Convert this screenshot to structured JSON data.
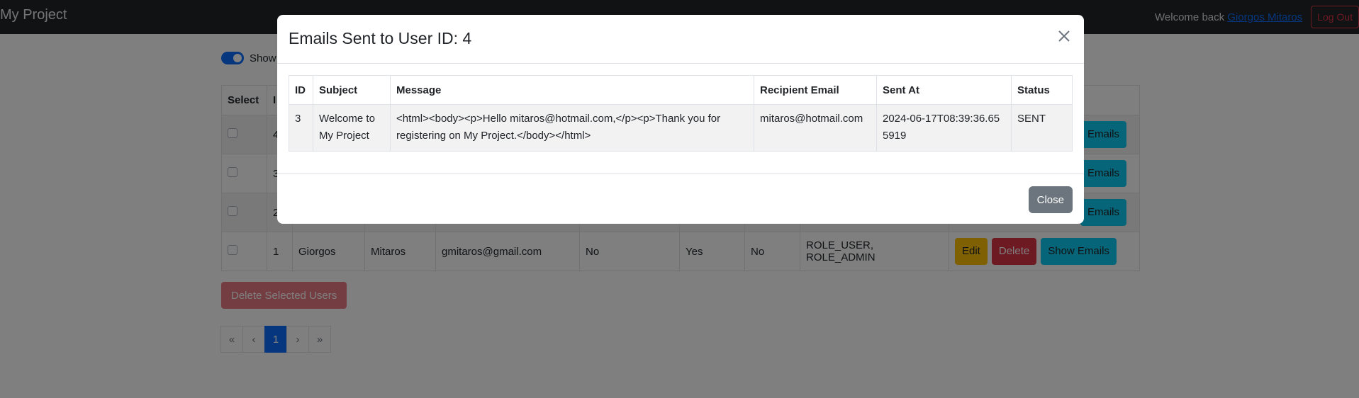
{
  "navbar": {
    "brand": "My Project",
    "welcome_text": "Welcome back",
    "user_name": "Giorgos Mitaros",
    "logout_label": "Log Out"
  },
  "page": {
    "toggle_label": "Show",
    "table": {
      "headers": [
        "Select",
        "I",
        "",
        "",
        "",
        "",
        "",
        "",
        "",
        ""
      ],
      "rows": [
        {
          "id": "4",
          "first": "",
          "last": "",
          "email": "",
          "verified": "",
          "enabled": "",
          "locked": "",
          "roles": "",
          "show_label": "Emails"
        },
        {
          "id": "3",
          "first": "",
          "last": "",
          "email": "",
          "verified": "",
          "enabled": "",
          "locked": "",
          "roles": "",
          "show_label": "Emails"
        },
        {
          "id": "2",
          "first": "",
          "last": "",
          "email": "",
          "verified": "",
          "enabled": "",
          "locked": "",
          "roles": "",
          "show_label": "Emails"
        },
        {
          "id": "1",
          "first": "Giorgos",
          "last": "Mitaros",
          "email": "gmitaros@gmail.com",
          "verified": "No",
          "enabled": "Yes",
          "locked": "No",
          "roles": "ROLE_USER, ROLE_ADMIN",
          "edit_label": "Edit",
          "delete_label": "Delete",
          "show_label": "Show Emails"
        }
      ]
    },
    "delete_selected_label": "Delete Selected Users",
    "pagination": [
      "«",
      "‹",
      "1",
      "›",
      "»"
    ]
  },
  "modal": {
    "title": "Emails Sent to User ID: 4",
    "headers": [
      "ID",
      "Subject",
      "Message",
      "Recipient Email",
      "Sent At",
      "Status"
    ],
    "rows": [
      {
        "id": "3",
        "subject": "Welcome to My Project",
        "message": "<html><body><p>Hello mitaros@hotmail.com,</p><p>Thank you for registering on My Project.</body></html>",
        "recipient": "mitaros@hotmail.com",
        "sent_at": "2024-06-17T08:39:36.655919",
        "status": "SENT"
      }
    ],
    "close_label": "Close"
  },
  "colors": {
    "navbar_bg": "#212529",
    "primary": "#0d6efd",
    "danger": "#dc3545",
    "warning": "#ffc107",
    "info": "#0dcaf0",
    "secondary": "#6c757d"
  }
}
